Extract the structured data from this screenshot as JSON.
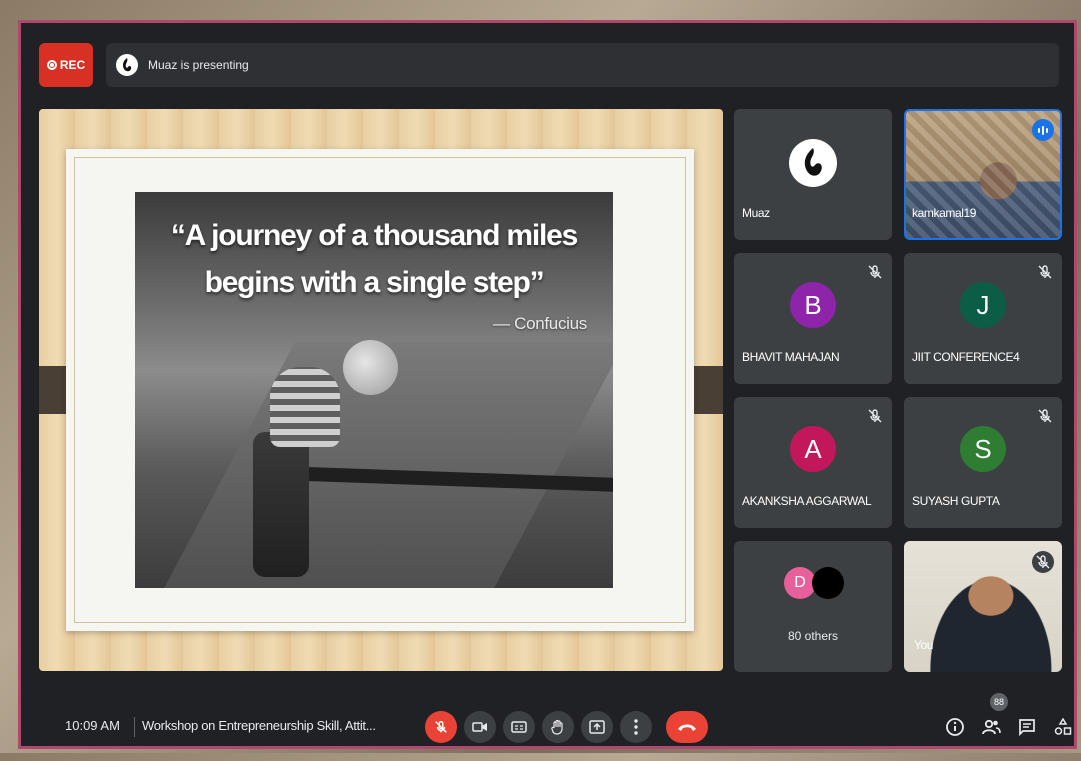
{
  "recording": {
    "label": "REC"
  },
  "presenting": {
    "text": "Muaz is presenting"
  },
  "slide": {
    "quote_line1": "“A journey of a thousand miles",
    "quote_line2": "begins with a single step”",
    "author": "— Confucius"
  },
  "participants": [
    {
      "name": "Muaz",
      "type": "logo",
      "muted": false
    },
    {
      "name": "kamkamal19",
      "type": "video",
      "speaking": true
    },
    {
      "name": "BHAVIT MAHAJAN",
      "initial": "B",
      "color": "#8e24aa",
      "muted": true
    },
    {
      "name": "JIIT CONFERENCE4",
      "initial": "J",
      "color": "#0b5e45",
      "muted": true
    },
    {
      "name": "AKANKSHA AGGARWAL",
      "initial": "A",
      "color": "#c2185b",
      "muted": true
    },
    {
      "name": "SUYASH GUPTA",
      "initial": "S",
      "color": "#2e7d32",
      "muted": true
    },
    {
      "name": "80 others",
      "type": "others",
      "initial": "D",
      "color": "#e8609a"
    },
    {
      "name": "You",
      "type": "video",
      "muted": true
    }
  ],
  "bottom": {
    "time": "10:09 AM",
    "meeting_title": "Workshop on Entrepreneurship Skill, Attit...",
    "participant_count": "88"
  },
  "colors": {
    "accent_red": "#ea4335",
    "speaking_blue": "#1a73e8",
    "frame_border": "#b0476f"
  }
}
